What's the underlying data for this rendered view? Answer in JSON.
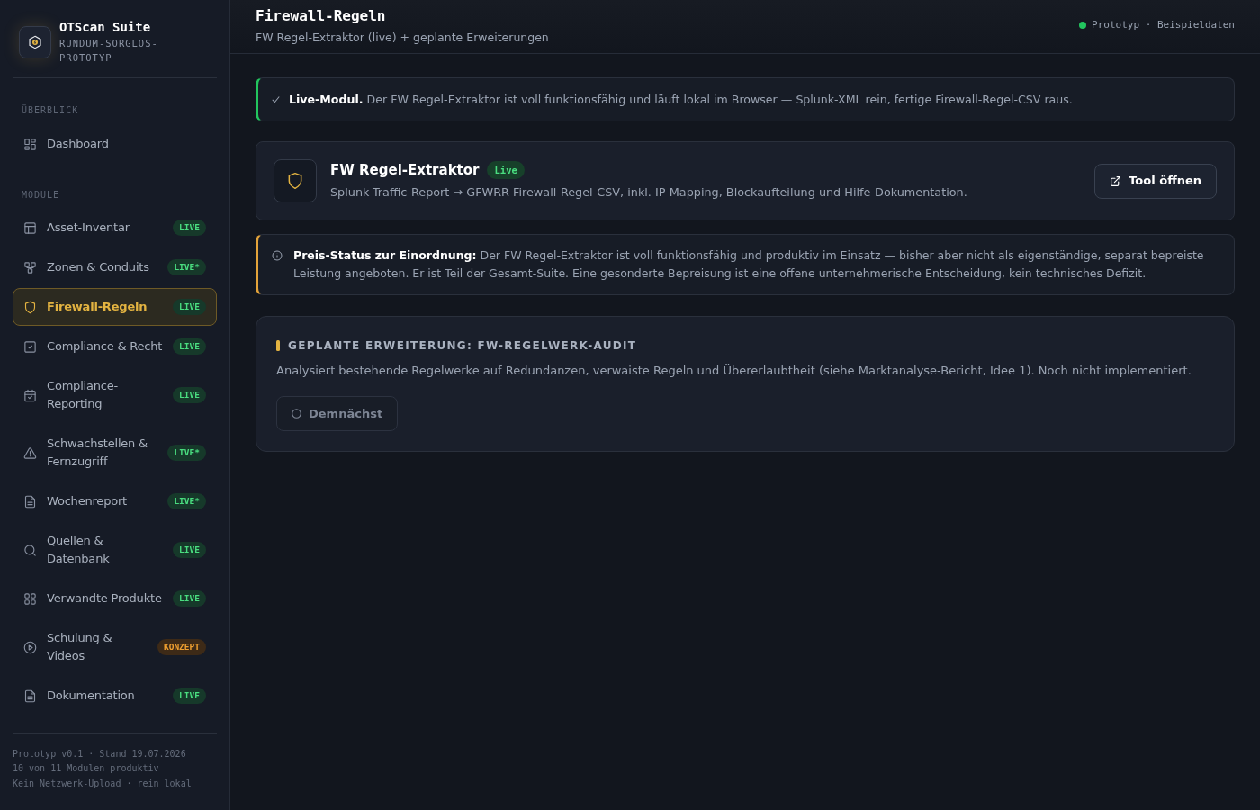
{
  "sidebar": {
    "brand": {
      "title": "OTScan Suite",
      "subtitle": "RUNDUM-SORGLOS-PROTOTYP"
    },
    "sections": [
      {
        "label": "ÜBERBLICK",
        "items": [
          {
            "label": "Dashboard",
            "selected": false
          }
        ]
      },
      {
        "label": "MODULE",
        "items": [
          {
            "label": "Asset-Inventar",
            "selected": false,
            "badge": {
              "text": "LIVE",
              "kind": "live"
            }
          },
          {
            "label": "Zonen & Conduits",
            "selected": false,
            "badge": {
              "text": "LIVE*",
              "kind": "live"
            }
          },
          {
            "label": "Firewall-Regeln",
            "selected": true,
            "badge": {
              "text": "LIVE",
              "kind": "live"
            }
          },
          {
            "label": "Compliance & Recht",
            "selected": false,
            "badge": {
              "text": "LIVE",
              "kind": "live"
            }
          },
          {
            "label": "Compliance-Reporting",
            "selected": false,
            "badge": {
              "text": "LIVE",
              "kind": "live"
            }
          },
          {
            "label": "Schwachstellen & Fernzugriff",
            "selected": false,
            "badge": {
              "text": "LIVE*",
              "kind": "live"
            }
          },
          {
            "label": "Wochenreport",
            "selected": false,
            "badge": {
              "text": "LIVE*",
              "kind": "live"
            }
          },
          {
            "label": "Quellen & Datenbank",
            "selected": false,
            "badge": {
              "text": "LIVE",
              "kind": "live"
            }
          },
          {
            "label": "Verwandte Produkte",
            "selected": false,
            "badge": {
              "text": "LIVE",
              "kind": "live"
            }
          },
          {
            "label": "Schulung & Videos",
            "selected": false,
            "badge": {
              "text": "KONZEPT",
              "kind": "concept"
            }
          },
          {
            "label": "Dokumentation",
            "selected": false,
            "badge": {
              "text": "LIVE",
              "kind": "live"
            }
          }
        ]
      }
    ],
    "footer": [
      "Prototyp v0.1 · Stand 19.07.2026",
      "10 von 11 Modulen produktiv",
      "Kein Netzwerk-Upload · rein lokal"
    ]
  },
  "header": {
    "title": "Firewall-Regeln",
    "subtitle": "FW Regel-Extraktor (live) + geplante Erweiterungen",
    "status": "Prototyp · Beispieldaten"
  },
  "live_notice": "**Live-Modul.** Der FW Regel-Extraktor ist voll funktionsfähig und läuft lokal im Browser — Splunk-XML rein, fertige Firewall-Regel-CSV raus.",
  "tool_card": {
    "title": "FW Regel-Extraktor",
    "badge": "Live",
    "description": "Splunk-Traffic-Report → GFWRR-Firewall-Regel-CSV, inkl. IP-Mapping, Blockaufteilung und Hilfe-Dokumentation.",
    "button": "Tool öffnen"
  },
  "price_notice": "**Preis-Status zur Einordnung:** Der FW Regel-Extraktor ist voll funktionsfähig und produktiv im Einsatz — bisher aber nicht als eigenständige, separat bepreiste Leistung angeboten. Er ist Teil der Gesamt-Suite. Eine gesonderte Bepreisung ist eine offene unternehmerische Entscheidung, kein technisches Defizit.",
  "planned_extension": {
    "heading": "GEPLANTE ERWEITERUNG: FW-REGELWERK-AUDIT",
    "description": "Analysiert bestehende Regelwerke auf Redundanzen, verwaiste Regeln und Übererlaubtheit (siehe Marktanalyse-Bericht, Idee 1). Noch nicht implementiert.",
    "button": {
      "label": "Demnächst",
      "disabled": true
    }
  }
}
